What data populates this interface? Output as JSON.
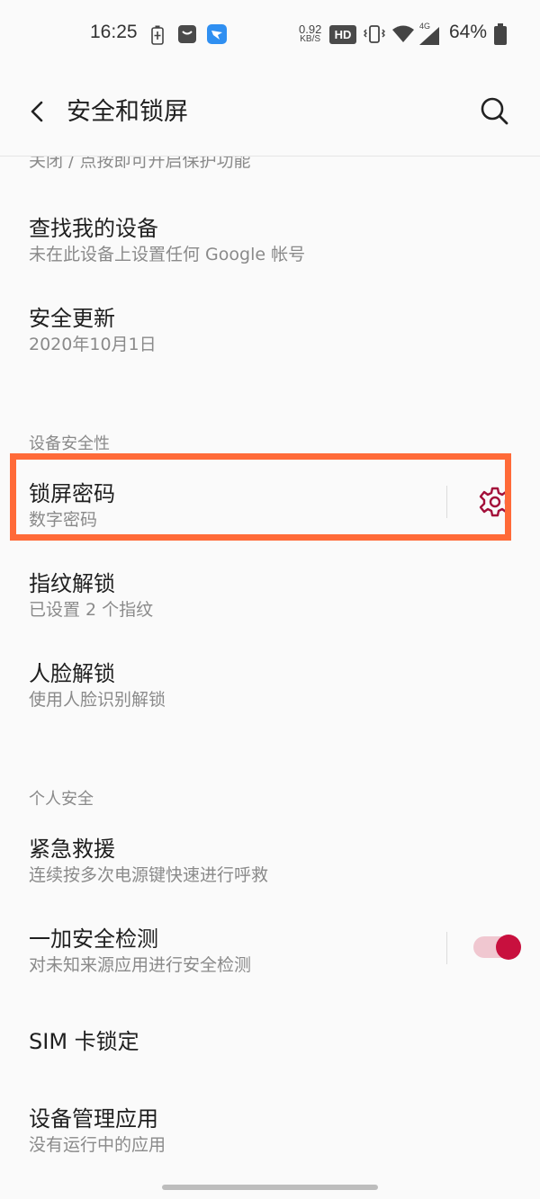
{
  "status_bar": {
    "time": "16:25",
    "net_speed_value": "0.92",
    "net_speed_unit": "KB/S",
    "hd_label": "HD",
    "network_label": "4G",
    "battery_percent": "64%"
  },
  "app_bar": {
    "title": "安全和锁屏"
  },
  "partial_item_subtitle": "关闭 / 点按即可开启保护功能",
  "items": {
    "find_device": {
      "title": "查找我的设备",
      "subtitle": "未在此设备上设置任何 Google 帐号"
    },
    "security_update": {
      "title": "安全更新",
      "subtitle": "2020年10月1日"
    },
    "lock_password": {
      "title": "锁屏密码",
      "subtitle": "数字密码"
    },
    "fingerprint": {
      "title": "指纹解锁",
      "subtitle": "已设置 2 个指纹"
    },
    "face_unlock": {
      "title": "人脸解锁",
      "subtitle": "使用人脸识别解锁"
    },
    "emergency": {
      "title": "紧急救援",
      "subtitle": "连续按多次电源键快速进行呼救"
    },
    "oneplus_check": {
      "title": "一加安全检测",
      "subtitle": "对未知来源应用进行安全检测",
      "toggle_on": true
    },
    "sim_lock": {
      "title": "SIM 卡锁定"
    },
    "device_admin": {
      "title": "设备管理应用",
      "subtitle": "没有运行中的应用"
    }
  },
  "sections": {
    "device_security": "设备安全性",
    "personal_security": "个人安全"
  },
  "colors": {
    "accent": "#c8103e",
    "highlight_box": "#ff6a38",
    "toggle_track": "#f0c7d0"
  },
  "icons": [
    "back-icon",
    "search-icon",
    "gear-icon"
  ]
}
